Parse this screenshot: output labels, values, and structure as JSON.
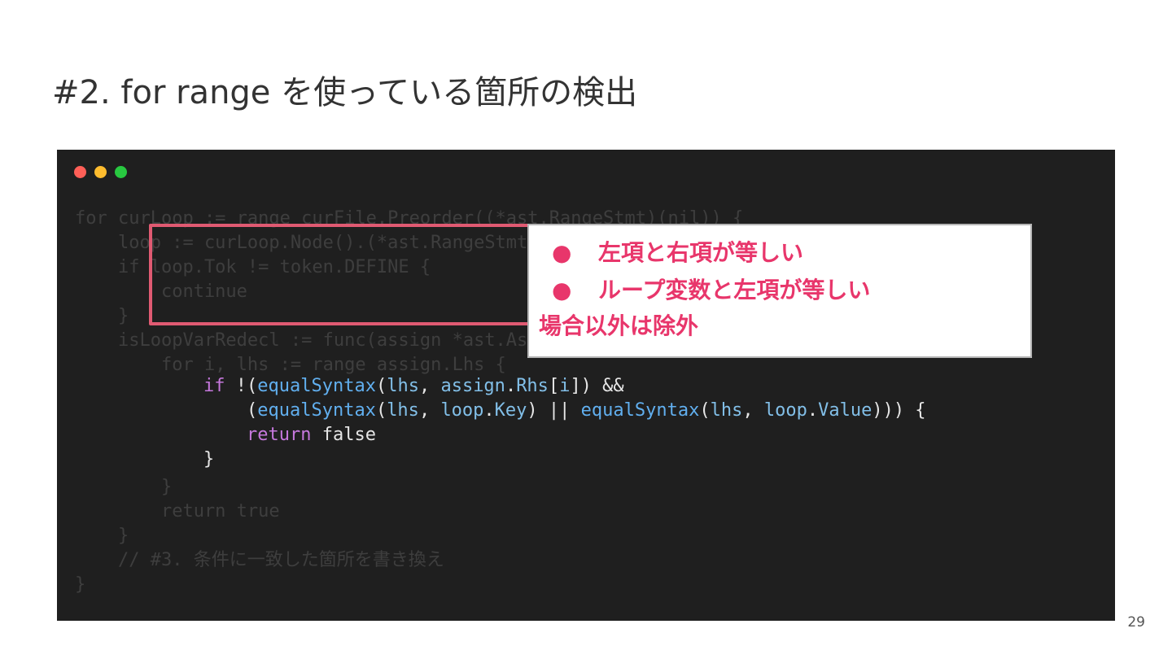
{
  "slide": {
    "title": "#2. for range を使っている箇所の検出",
    "page_number": "29"
  },
  "window": {
    "controls": [
      {
        "name": "close",
        "color": "#ff5f57"
      },
      {
        "name": "minimize",
        "color": "#febc2e"
      },
      {
        "name": "maximize",
        "color": "#28c840"
      }
    ]
  },
  "code": {
    "dim_lines": [
      "for curLoop := range curFile.Preorder((*ast.RangeStmt)(nil)) {",
      "    loop := curLoop.Node().(*ast.RangeStmt)",
      "    if loop.Tok != token.DEFINE {",
      "        continue",
      "    }",
      "    isLoopVarRedecl := func(assign *ast.AssignStmt) bool {",
      "        for i, lhs := range assign.Lhs {",
      "",
      "",
      "",
      "",
      "        }",
      "        return true",
      "    }",
      "    // #3. 条件に一致した箇所を書き換え",
      "}"
    ],
    "highlight": {
      "line1": {
        "kw_if": "if",
        "p1": " !(",
        "fn1": "equalSyntax",
        "p2": "(",
        "id1": "lhs",
        "p3": ", ",
        "id2": "assign",
        "p4": ".",
        "id3": "Rhs",
        "p5": "[",
        "id4": "i",
        "p6": "]) &&"
      },
      "line2": {
        "p0": "    (",
        "fn1": "equalSyntax",
        "p1": "(",
        "id1": "lhs",
        "p2": ", ",
        "id2": "loop",
        "p3": ".",
        "id3": "Key",
        "p4": ") || ",
        "fn2": "equalSyntax",
        "p5": "(",
        "id4": "lhs",
        "p6": ", ",
        "id5": "loop",
        "p7": ".",
        "id6": "Value",
        "p8": "))) {"
      },
      "line3": {
        "p0": "    ",
        "kw_return": "return",
        "p1": " false"
      },
      "line4": {
        "p0": "}"
      }
    }
  },
  "callout": {
    "items": [
      {
        "bullet": "●",
        "text": "左項と右項が等しい"
      },
      {
        "bullet": "●",
        "text": "ループ変数と左項が等しい"
      }
    ],
    "footer": "場合以外は除外",
    "text_color": "#e8366b",
    "frame_color": "#e05a72"
  }
}
